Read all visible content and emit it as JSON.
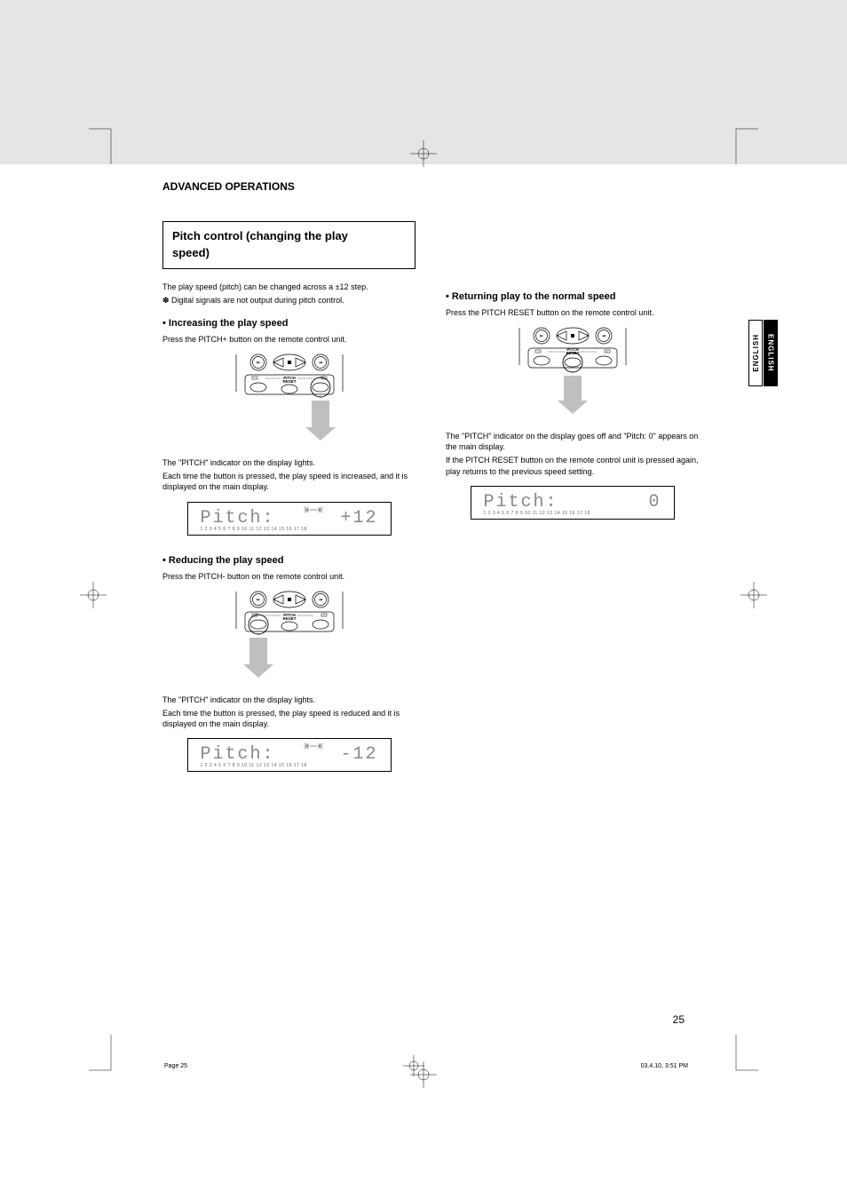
{
  "section_heading": "ADVANCED OPERATIONS",
  "box_title_line1": "Pitch control (changing the play",
  "box_title_line2": "speed)",
  "intro_line": "The play speed (pitch) can be changed across a ±12 step.",
  "intro_note": "Digital signals are not output during pitch control.",
  "increasing": {
    "heading": "Increasing the play speed",
    "instruction": "Press the PITCH+ button on the remote control unit.",
    "desc_line1": "The \"PITCH\" indicator on the display lights.",
    "desc_line2": "Each time the button is pressed, the play speed is increased, and it is displayed on the main display.",
    "display_label": "Pitch:",
    "display_value": "+12",
    "track_row": "1 2   3 4   5 6   7 8   9 10  11 12  13 14  15 16  17 18"
  },
  "reducing": {
    "heading": "Reducing the play speed",
    "instruction": "Press the PITCH- button on the remote control unit.",
    "desc_line1": "The \"PITCH\" indicator on the display lights.",
    "desc_line2": "Each time the button is pressed, the play speed is reduced and it is displayed on the main display.",
    "display_label": "Pitch:",
    "display_value": "-12",
    "track_row": "1 2   3 4   5 6   7 8   9 10  11 12  13 14  15 16  17 18"
  },
  "returning": {
    "heading": "Returning play to the normal speed",
    "instruction": "Press the PITCH RESET button on the remote control unit.",
    "desc_line1": "The \"PITCH\" indicator on the display goes off and \"Pitch: 0\" appears on the main display.",
    "desc_line2": "If the PITCH RESET button on the remote control unit is pressed again, play returns to the previous speed setting.",
    "display_label": "Pitch:",
    "display_value": "0",
    "track_row": "1 2   3 4   5 6   7 8   9 10  11 12  13 14  15 16  17 18"
  },
  "side_tabs": {
    "left": "ENGLISH",
    "right": "ENGLISH"
  },
  "page_number": "25",
  "footer": {
    "left": "Page 25",
    "right": "03.4.10, 3:51 PM"
  },
  "remote_label": "PITCH\nRESET"
}
